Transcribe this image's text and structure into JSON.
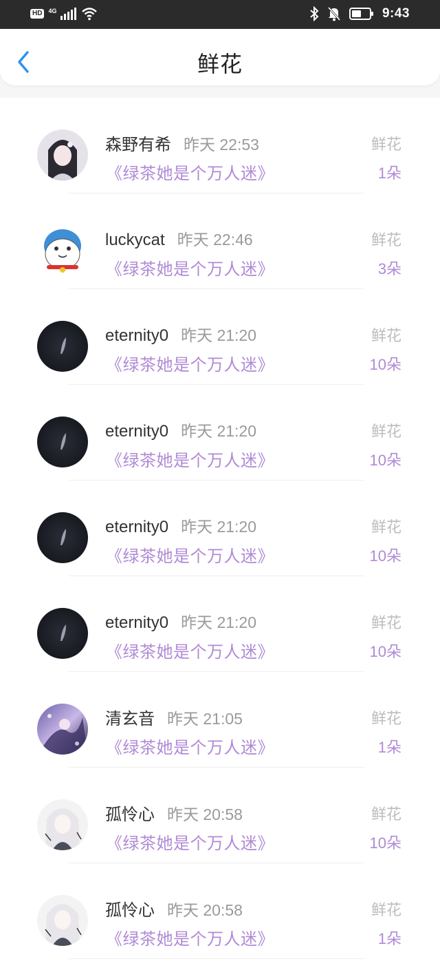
{
  "status_bar": {
    "hd": "HD",
    "network": "4G",
    "time": "9:43",
    "icons": [
      "signal-icon",
      "wifi-icon",
      "bluetooth-icon",
      "mute-bell-icon",
      "battery-icon"
    ]
  },
  "header": {
    "title": "鲜花",
    "back_icon": "chevron-left-icon"
  },
  "colors": {
    "accent_purple": "#b08ad6",
    "back_blue": "#2d8ff0",
    "status_bar_bg": "#2b2b2b"
  },
  "items": [
    {
      "user": "森野有希",
      "time": "昨天 22:53",
      "book": "《绿茶她是个万人迷》",
      "gift": "鲜花",
      "count": "1朵",
      "avatar": "anime-girl-dark-hair"
    },
    {
      "user": "luckycat",
      "time": "昨天 22:46",
      "book": "《绿茶她是个万人迷》",
      "gift": "鲜花",
      "count": "3朵",
      "avatar": "cartoon-cat"
    },
    {
      "user": "eternity0",
      "time": "昨天 21:20",
      "book": "《绿茶她是个万人迷》",
      "gift": "鲜花",
      "count": "10朵",
      "avatar": "dark-feather"
    },
    {
      "user": "eternity0",
      "time": "昨天 21:20",
      "book": "《绿茶她是个万人迷》",
      "gift": "鲜花",
      "count": "10朵",
      "avatar": "dark-feather"
    },
    {
      "user": "eternity0",
      "time": "昨天 21:20",
      "book": "《绿茶她是个万人迷》",
      "gift": "鲜花",
      "count": "10朵",
      "avatar": "dark-feather"
    },
    {
      "user": "eternity0",
      "time": "昨天 21:20",
      "book": "《绿茶她是个万人迷》",
      "gift": "鲜花",
      "count": "10朵",
      "avatar": "dark-feather"
    },
    {
      "user": "清玄音",
      "time": "昨天 21:05",
      "book": "《绿茶她是个万人迷》",
      "gift": "鲜花",
      "count": "1朵",
      "avatar": "anime-purple-scene"
    },
    {
      "user": "孤怜心",
      "time": "昨天 20:58",
      "book": "《绿茶她是个万人迷》",
      "gift": "鲜花",
      "count": "10朵",
      "avatar": "anime-white-hair"
    },
    {
      "user": "孤怜心",
      "time": "昨天 20:58",
      "book": "《绿茶她是个万人迷》",
      "gift": "鲜花",
      "count": "1朵",
      "avatar": "anime-white-hair"
    }
  ]
}
